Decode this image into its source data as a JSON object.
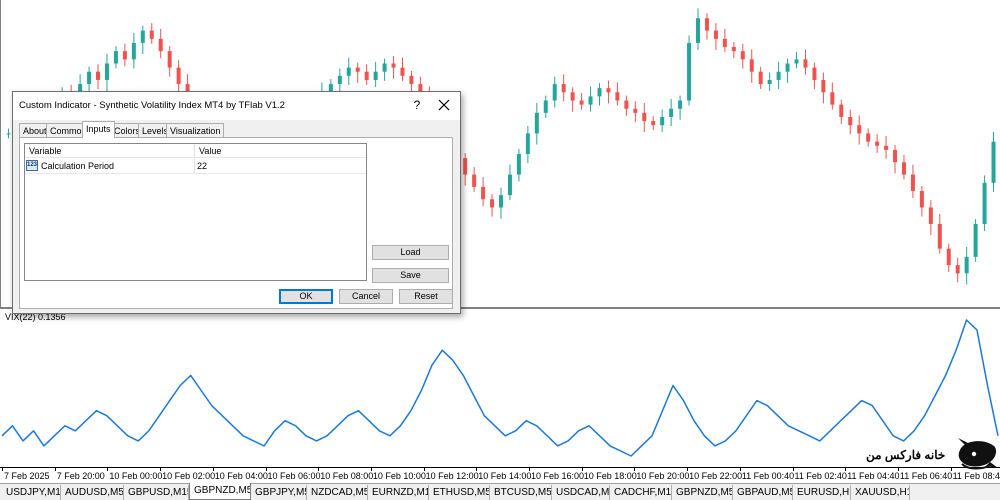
{
  "window": {
    "indicator_label": "VIX(22) 0.1356"
  },
  "time_axis": {
    "labels": [
      "7 Feb 2025",
      "7 Feb 20:00",
      "10 Feb 00:00",
      "10 Feb 02:00",
      "10 Feb 04:00",
      "10 Feb 06:00",
      "10 Feb 08:00",
      "10 Feb 10:00",
      "10 Feb 12:00",
      "10 Feb 14:00",
      "10 Feb 16:00",
      "10 Feb 18:00",
      "10 Feb 20:00",
      "10 Feb 22:00",
      "11 Feb 00:40",
      "11 Feb 02:40",
      "11 Feb 04:40",
      "11 Feb 06:40",
      "11 Feb 08:40"
    ]
  },
  "symbol_tabs": {
    "items": [
      "USDJPY,M1",
      "AUDUSD,M5",
      "GBPUSD,M15",
      "GBPNZD,M5",
      "GBPJPY,M5",
      "NZDCAD,M5",
      "EURNZD,M1",
      "ETHUSD,M5",
      "BTCUSD,M5",
      "USDCAD,M5",
      "CADCHF,M1",
      "GBPNZD,M5",
      "GBPAUD,M5",
      "EURUSD,H1",
      "XAUUSD,H1"
    ],
    "active_index": 3
  },
  "dialog": {
    "title": "Custom Indicator - Synthetic Volatility Index MT4 by TFlab V1.2",
    "help_label": "?",
    "tabs": [
      "About",
      "Common",
      "Inputs",
      "Colors",
      "Levels",
      "Visualization"
    ],
    "active_tab": "Inputs",
    "table": {
      "headers": [
        "Variable",
        "Value"
      ],
      "rows": [
        {
          "icon": "123",
          "variable": "Calculation Period",
          "value": "22"
        }
      ]
    },
    "buttons": {
      "load": "Load",
      "save": "Save",
      "ok": "OK",
      "cancel": "Cancel",
      "reset": "Reset"
    }
  },
  "branding": {
    "logo_text": "خانه فارکس من"
  },
  "colors": {
    "bull_candle": "#26a69a",
    "bear_candle": "#ef5350",
    "indicator_line": "#1e78d8",
    "separator": "#808080"
  },
  "chart_data": [
    {
      "type": "candlestick",
      "series": [
        {
          "name": "GBPNZD,M5",
          "close": [
            40,
            38,
            42,
            45,
            43,
            47,
            50,
            48,
            52,
            55,
            53,
            57,
            60,
            58,
            62,
            65,
            63,
            60,
            56,
            52,
            48,
            45,
            43,
            40,
            42,
            44,
            41,
            38,
            36,
            38,
            40,
            39,
            41,
            44,
            47,
            50,
            52,
            54,
            56,
            55,
            53,
            55,
            57,
            56,
            54,
            52,
            49,
            45,
            42,
            38,
            34,
            30,
            27,
            24,
            22,
            25,
            30,
            35,
            40,
            45,
            48,
            52,
            50,
            48,
            47,
            49,
            51,
            50,
            48,
            46,
            45,
            43,
            42,
            44,
            46,
            48,
            62,
            68,
            65,
            63,
            61,
            60,
            58,
            55,
            52,
            53,
            55,
            57,
            58,
            56,
            53,
            50,
            47,
            44,
            42,
            40,
            38,
            37,
            36,
            33,
            30,
            26,
            22,
            18,
            12,
            8,
            6,
            10,
            18,
            28,
            38
          ]
        }
      ]
    },
    {
      "type": "line",
      "series": [
        {
          "name": "VIX(22) 0.1356",
          "values": [
            0.1,
            0.12,
            0.09,
            0.11,
            0.08,
            0.1,
            0.12,
            0.11,
            0.13,
            0.15,
            0.14,
            0.12,
            0.1,
            0.09,
            0.11,
            0.14,
            0.17,
            0.2,
            0.22,
            0.19,
            0.16,
            0.14,
            0.12,
            0.1,
            0.09,
            0.08,
            0.11,
            0.13,
            0.12,
            0.1,
            0.09,
            0.1,
            0.12,
            0.14,
            0.15,
            0.13,
            0.11,
            0.1,
            0.12,
            0.15,
            0.19,
            0.24,
            0.27,
            0.25,
            0.22,
            0.18,
            0.14,
            0.12,
            0.1,
            0.11,
            0.13,
            0.12,
            0.1,
            0.08,
            0.09,
            0.11,
            0.12,
            0.1,
            0.08,
            0.07,
            0.06,
            0.08,
            0.1,
            0.15,
            0.2,
            0.17,
            0.13,
            0.1,
            0.08,
            0.09,
            0.11,
            0.14,
            0.17,
            0.16,
            0.14,
            0.12,
            0.11,
            0.1,
            0.09,
            0.11,
            0.13,
            0.15,
            0.17,
            0.16,
            0.13,
            0.1,
            0.09,
            0.11,
            0.14,
            0.18,
            0.22,
            0.27,
            0.33,
            0.31,
            0.2,
            0.1
          ]
        }
      ]
    }
  ]
}
